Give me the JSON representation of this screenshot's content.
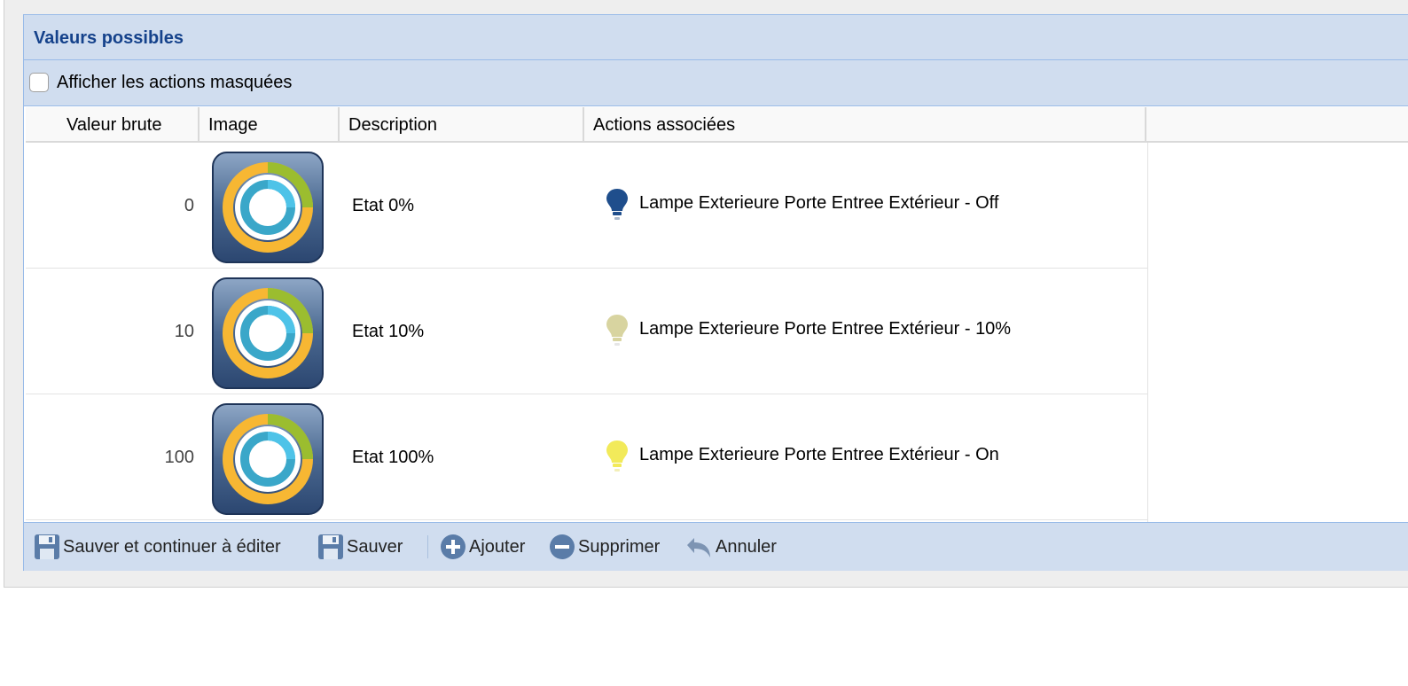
{
  "panel": {
    "title": "Valeurs possibles"
  },
  "toolbar": {
    "show_hidden_label": "Afficher les actions masquées",
    "show_hidden_checked": false
  },
  "grid": {
    "columns": [
      "Valeur brute",
      "Image",
      "Description",
      "Actions associées"
    ],
    "rows": [
      {
        "value": "0",
        "image_icon": "ring-gauge-icon",
        "description": "Etat 0%",
        "action": "Lampe Exterieure Porte Entree Extérieur - Off",
        "bulb_icon": "bulb-off-icon",
        "bulb_color": "#1f4e8c"
      },
      {
        "value": "10",
        "image_icon": "ring-gauge-icon",
        "description": "Etat 10%",
        "action": "Lampe Exterieure Porte Entree Extérieur - 10%",
        "bulb_icon": "bulb-dim-icon",
        "bulb_color": "#d8d4a0"
      },
      {
        "value": "100",
        "image_icon": "ring-gauge-icon",
        "description": "Etat 100%",
        "action": "Lampe Exterieure Porte Entree Extérieur - On",
        "bulb_icon": "bulb-on-icon",
        "bulb_color": "#f2ea5a"
      }
    ]
  },
  "bottombar": {
    "save_continue": "Sauver et continuer à éditer",
    "save": "Sauver",
    "add": "Ajouter",
    "delete": "Supprimer",
    "cancel": "Annuler"
  },
  "colors": {
    "accent": "#15428b",
    "bar_bg": "#d0ddef",
    "border": "#99bbe8"
  }
}
